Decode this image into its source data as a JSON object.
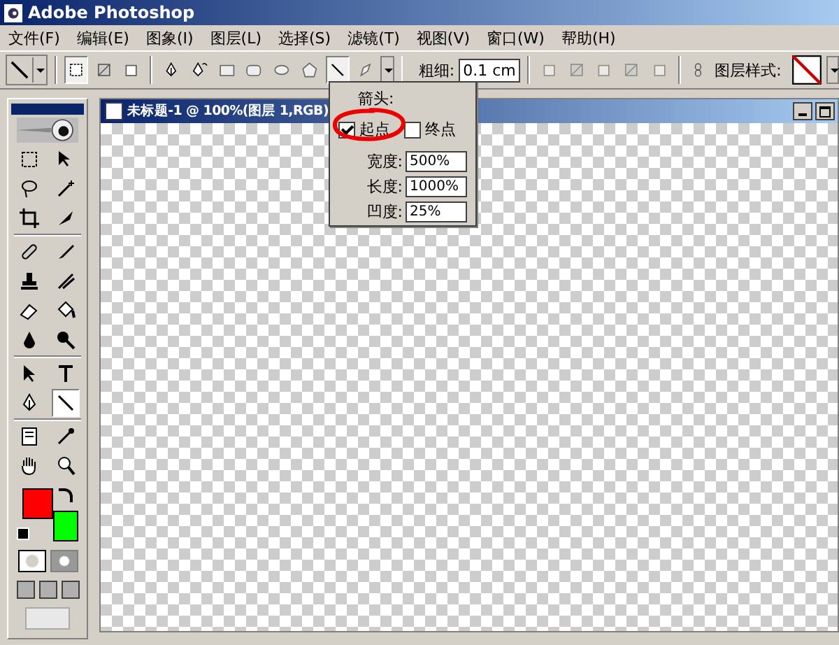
{
  "window": {
    "title": "Adobe Photoshop"
  },
  "menu": [
    {
      "label": "文件(F)"
    },
    {
      "label": "编辑(E)"
    },
    {
      "label": "图象(I)"
    },
    {
      "label": "图层(L)"
    },
    {
      "label": "选择(S)"
    },
    {
      "label": "滤镜(T)"
    },
    {
      "label": "视图(V)"
    },
    {
      "label": "窗口(W)"
    },
    {
      "label": "帮助(H)"
    }
  ],
  "options_bar": {
    "modes": [
      {
        "kind": "shape-layer",
        "selected": true
      },
      {
        "kind": "path",
        "selected": false
      },
      {
        "kind": "fill",
        "selected": false
      }
    ],
    "shapes": [
      {
        "kind": "pen",
        "selected": false
      },
      {
        "kind": "freeform-pen",
        "selected": false
      },
      {
        "kind": "rectangle",
        "selected": false
      },
      {
        "kind": "rounded-rectangle",
        "selected": false
      },
      {
        "kind": "ellipse",
        "selected": false
      },
      {
        "kind": "polygon",
        "selected": false
      },
      {
        "kind": "line",
        "selected": true
      },
      {
        "kind": "custom-shape",
        "selected": false
      }
    ],
    "weight_label": "粗细:",
    "weight_value": "0.1 cm",
    "layer_style_label": "图层样式:"
  },
  "arrowheads_popup": {
    "title": "箭头:",
    "start": {
      "label": "起点",
      "checked": true
    },
    "end": {
      "label": "终点",
      "checked": false
    },
    "fields": [
      {
        "label": "宽度:",
        "value": "500%"
      },
      {
        "label": "长度:",
        "value": "1000%"
      },
      {
        "label": "凹度:",
        "value": "25%"
      }
    ]
  },
  "toolbox": {
    "tools": [
      {
        "kind": "marquee",
        "selected": false
      },
      {
        "kind": "move",
        "selected": false
      },
      {
        "kind": "lasso",
        "selected": false
      },
      {
        "kind": "wand",
        "selected": false
      },
      {
        "kind": "crop",
        "selected": false
      },
      {
        "kind": "knife",
        "selected": false
      },
      {
        "kind": "bandage",
        "selected": false
      },
      {
        "kind": "brush",
        "selected": false
      },
      {
        "kind": "stamp",
        "selected": false
      },
      {
        "kind": "history-brush",
        "selected": false
      },
      {
        "kind": "eraser",
        "selected": false
      },
      {
        "kind": "bucket",
        "selected": false
      },
      {
        "kind": "blur",
        "selected": false
      },
      {
        "kind": "dodge",
        "selected": false
      },
      {
        "kind": "arrow",
        "selected": false
      },
      {
        "kind": "type",
        "selected": false
      },
      {
        "kind": "pen",
        "selected": false
      },
      {
        "kind": "line",
        "selected": true
      },
      {
        "kind": "note",
        "selected": false
      },
      {
        "kind": "eyedropper",
        "selected": false
      },
      {
        "kind": "hand",
        "selected": false
      },
      {
        "kind": "zoom",
        "selected": false
      }
    ],
    "foreground": {
      "color": "#ff0000"
    },
    "background": {
      "color": "#00ff00"
    }
  },
  "document": {
    "title": "未标题-1 @ 100%(图层 1,RGB)"
  }
}
